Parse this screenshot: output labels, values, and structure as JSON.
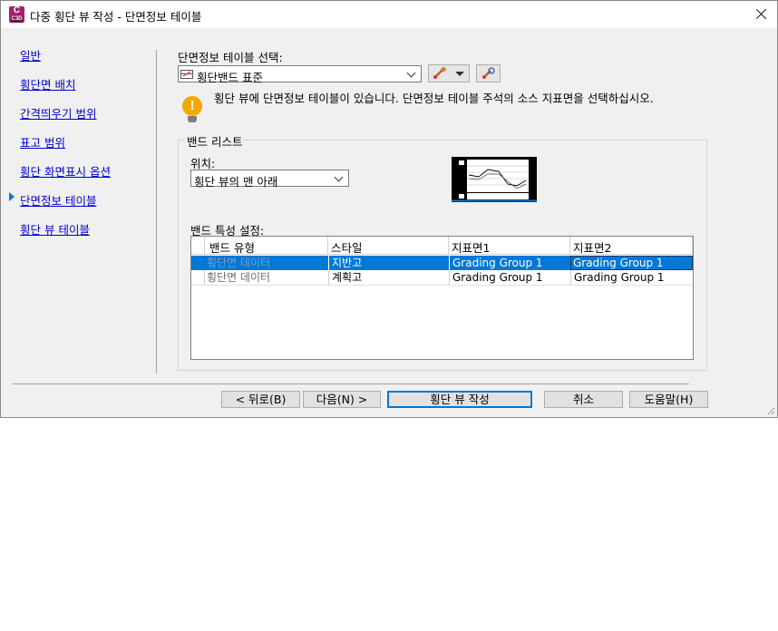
{
  "window": {
    "title": "다중 횡단 뷰 작성 - 단면정보 테이블",
    "app_icon_letter": "C",
    "app_icon_sub": "C3D"
  },
  "nav": {
    "items": [
      {
        "label": "일반"
      },
      {
        "label": "횡단면 배치"
      },
      {
        "label": "간격띄우기 범위"
      },
      {
        "label": "표고 범위"
      },
      {
        "label": "횡단 화면표시 옵션"
      },
      {
        "label": "단면정보 테이블",
        "current": true
      },
      {
        "label": "횡단 뷰 테이블"
      }
    ],
    "current_indicator": "arrow-right"
  },
  "band_set": {
    "label": "단면정보 테이블 선택:",
    "value": "횡단밴드 표준",
    "icons": [
      "band-set-icon",
      "edit-style-icon",
      "dropdown-arrow-icon",
      "pick-style-icon"
    ]
  },
  "message": {
    "icon": "warning-lightbulb-icon",
    "text": "횡단 뷰에 단면정보 테이블이 있습니다. 단면정보 테이블 주석의 소스 지표면을 선택하십시오."
  },
  "band_list": {
    "group_title": "밴드 리스트",
    "position_label": "위치:",
    "position_value": "횡단 뷰의 맨 아래",
    "preview_icon": "band-preview-thumbnail",
    "properties_label": "밴드 특성 설정:",
    "columns": [
      "밴드 유형",
      "스타일",
      "지표면1",
      "지표면2"
    ],
    "rows": [
      {
        "type": "횡단면 데이터",
        "style": "지반고",
        "surface1": "Grading Group 1",
        "surface2": "Grading Group 1",
        "selected": true
      },
      {
        "type": "횡단면 데이터",
        "style": "계획고",
        "surface1": "Grading Group 1",
        "surface2": "Grading Group 1",
        "selected": false
      }
    ]
  },
  "buttons": {
    "back": "< 뒤로(B)",
    "next": "다음(N) >",
    "create": "횡단 뷰 작성",
    "cancel": "취소",
    "help": "도움말(H)"
  },
  "colors": {
    "selection": "#0078d7",
    "link": "#0000cc",
    "warning": "#f2a900",
    "app_icon": "#a5216e"
  }
}
